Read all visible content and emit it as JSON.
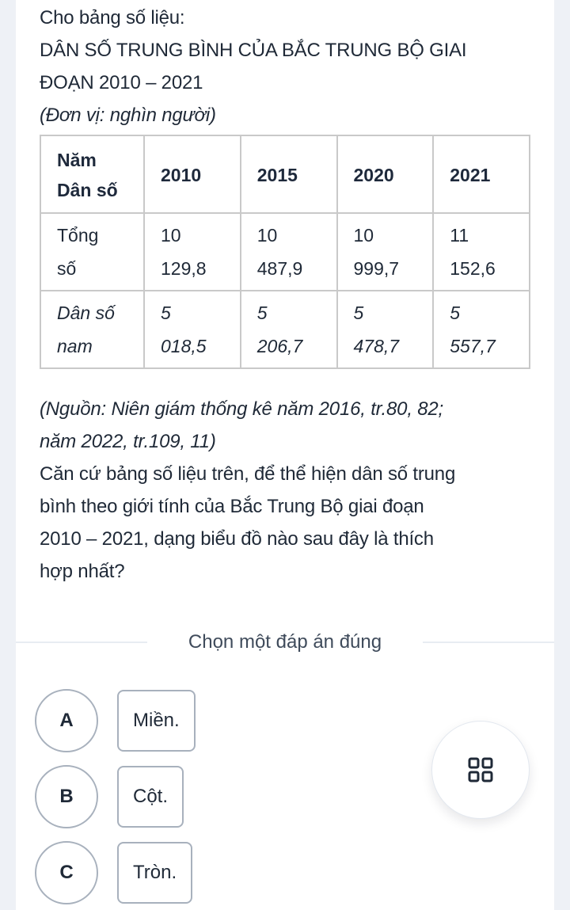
{
  "question": {
    "intro": "Cho bảng số liệu:",
    "table_title_line1": "DÂN SỐ TRUNG BÌNH CỦA BẮC TRUNG BỘ GIAI",
    "table_title_line2": "ĐOẠN 2010 – 2021",
    "unit": "(Đơn vị: nghìn người)",
    "table": {
      "corner_line1": "Năm",
      "corner_line2": "Dân số",
      "columns": [
        "2010",
        "2015",
        "2020",
        "2021"
      ],
      "rows": [
        {
          "label_line1": "Tổng",
          "label_line2": "số",
          "style": "normal",
          "values": [
            {
              "line1": "10",
              "line2": "129,8"
            },
            {
              "line1": "10",
              "line2": "487,9"
            },
            {
              "line1": "10",
              "line2": "999,7"
            },
            {
              "line1": "11",
              "line2": "152,6"
            }
          ]
        },
        {
          "label_line1": "Dân số",
          "label_line2": "nam",
          "style": "italic",
          "values": [
            {
              "line1": "5",
              "line2": "018,5"
            },
            {
              "line1": "5",
              "line2": "206,7"
            },
            {
              "line1": "5",
              "line2": "478,7"
            },
            {
              "line1": "5",
              "line2": "557,7"
            }
          ]
        }
      ]
    },
    "source_line1": "(Nguồn: Niên giám thống kê năm 2016, tr.80, 82;",
    "source_line2": "năm 2022, tr.109, 11)",
    "prompt_lines": [
      "Căn cứ bảng số liệu trên, để thể hiện dân số trung",
      "bình theo giới tính của Bắc Trung Bộ giai đoạn",
      "2010 – 2021, dạng biểu đồ nào sau đây là thích",
      "hợp nhất?"
    ]
  },
  "answer_section": {
    "label": "Chọn một đáp án đúng",
    "options": [
      {
        "letter": "A",
        "text": "Miền."
      },
      {
        "letter": "B",
        "text": "Cột."
      },
      {
        "letter": "C",
        "text": "Tròn."
      }
    ]
  },
  "fab": {
    "icon": "grid-icon"
  },
  "colors": {
    "page_background": "#eef1f6",
    "card_background": "#ffffff",
    "text": "#1f2937",
    "option_border": "#a8b1bd",
    "table_border": "#c9c9c9"
  }
}
